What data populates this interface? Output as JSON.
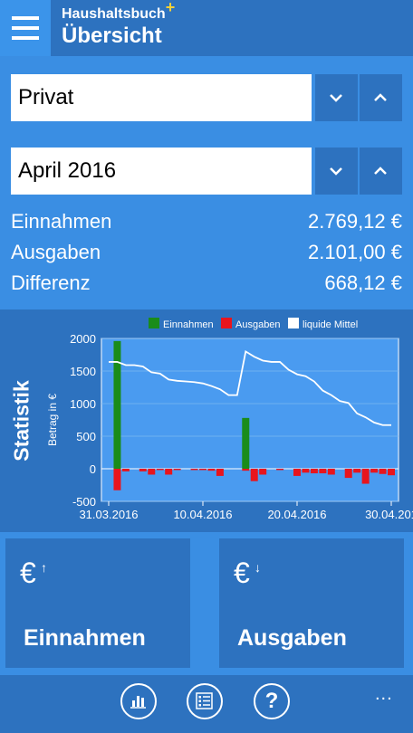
{
  "header": {
    "app_name": "Haushaltsbuch",
    "app_name_mark": "+",
    "page_title": "Übersicht",
    "menu_icon": "hamburger-icon"
  },
  "filters": {
    "account": "Privat",
    "month": "April 2016"
  },
  "summary": {
    "income_label": "Einnahmen",
    "income_value": "2.769,12 €",
    "expense_label": "Ausgaben",
    "expense_value": "2.101,00 €",
    "diff_label": "Differenz",
    "diff_value": "668,12 €"
  },
  "statistics": {
    "label": "Statistik"
  },
  "chart_data": {
    "type": "bar",
    "legend": [
      "Einnahmen",
      "Ausgaben",
      "liquide Mittel"
    ],
    "legend_position": "top",
    "ylabel": "Betrag in €",
    "ylim": [
      -500,
      2000
    ],
    "yticks": [
      "2000",
      "1500",
      "1000",
      "500",
      "0",
      "-500"
    ],
    "xticks": [
      "31.03.2016",
      "10.04.2016",
      "20.04.2016",
      "30.04.201"
    ],
    "x_range": [
      0,
      30
    ],
    "series": [
      {
        "name": "Einnahmen",
        "type": "bar",
        "color": "#1a8c1a",
        "points": [
          [
            1,
            1960
          ],
          [
            16,
            780
          ]
        ]
      },
      {
        "name": "Ausgaben",
        "type": "bar",
        "color": "#e8151d",
        "points": [
          [
            1,
            -330
          ],
          [
            2,
            -40
          ],
          [
            4,
            -40
          ],
          [
            5,
            -90
          ],
          [
            6,
            -20
          ],
          [
            7,
            -90
          ],
          [
            8,
            -20
          ],
          [
            10,
            -20
          ],
          [
            11,
            -20
          ],
          [
            12,
            -30
          ],
          [
            13,
            -110
          ],
          [
            16,
            -30
          ],
          [
            17,
            -190
          ],
          [
            18,
            -90
          ],
          [
            20,
            -20
          ],
          [
            22,
            -110
          ],
          [
            23,
            -60
          ],
          [
            24,
            -70
          ],
          [
            25,
            -70
          ],
          [
            26,
            -90
          ],
          [
            28,
            -140
          ],
          [
            29,
            -60
          ],
          [
            30,
            -230
          ],
          [
            31,
            -60
          ],
          [
            32,
            -80
          ],
          [
            33,
            -100
          ]
        ]
      },
      {
        "name": "liquide Mittel",
        "type": "line",
        "color": "#ffffff",
        "points": [
          [
            0,
            1640
          ],
          [
            1,
            1640
          ],
          [
            2,
            1590
          ],
          [
            3,
            1590
          ],
          [
            4,
            1570
          ],
          [
            5,
            1480
          ],
          [
            6,
            1460
          ],
          [
            7,
            1370
          ],
          [
            8,
            1350
          ],
          [
            9,
            1340
          ],
          [
            10,
            1330
          ],
          [
            11,
            1310
          ],
          [
            12,
            1270
          ],
          [
            13,
            1220
          ],
          [
            14,
            1130
          ],
          [
            15,
            1130
          ],
          [
            16,
            1800
          ],
          [
            17,
            1720
          ],
          [
            18,
            1660
          ],
          [
            19,
            1640
          ],
          [
            20,
            1640
          ],
          [
            21,
            1520
          ],
          [
            22,
            1450
          ],
          [
            23,
            1420
          ],
          [
            24,
            1340
          ],
          [
            25,
            1200
          ],
          [
            26,
            1130
          ],
          [
            27,
            1040
          ],
          [
            28,
            1010
          ],
          [
            29,
            850
          ],
          [
            30,
            790
          ],
          [
            31,
            710
          ],
          [
            32,
            670
          ],
          [
            33,
            670
          ]
        ]
      }
    ]
  },
  "tiles": {
    "income": {
      "label": "Einnahmen",
      "icon": "euro-up-icon",
      "symbol": "€",
      "arrow": "↑"
    },
    "expense": {
      "label": "Ausgaben",
      "icon": "euro-down-icon",
      "symbol": "€",
      "arrow": "↓"
    }
  },
  "appbar": {
    "buttons": [
      "statistics-icon",
      "list-icon",
      "help-icon"
    ],
    "help_glyph": "?",
    "more": "..."
  }
}
